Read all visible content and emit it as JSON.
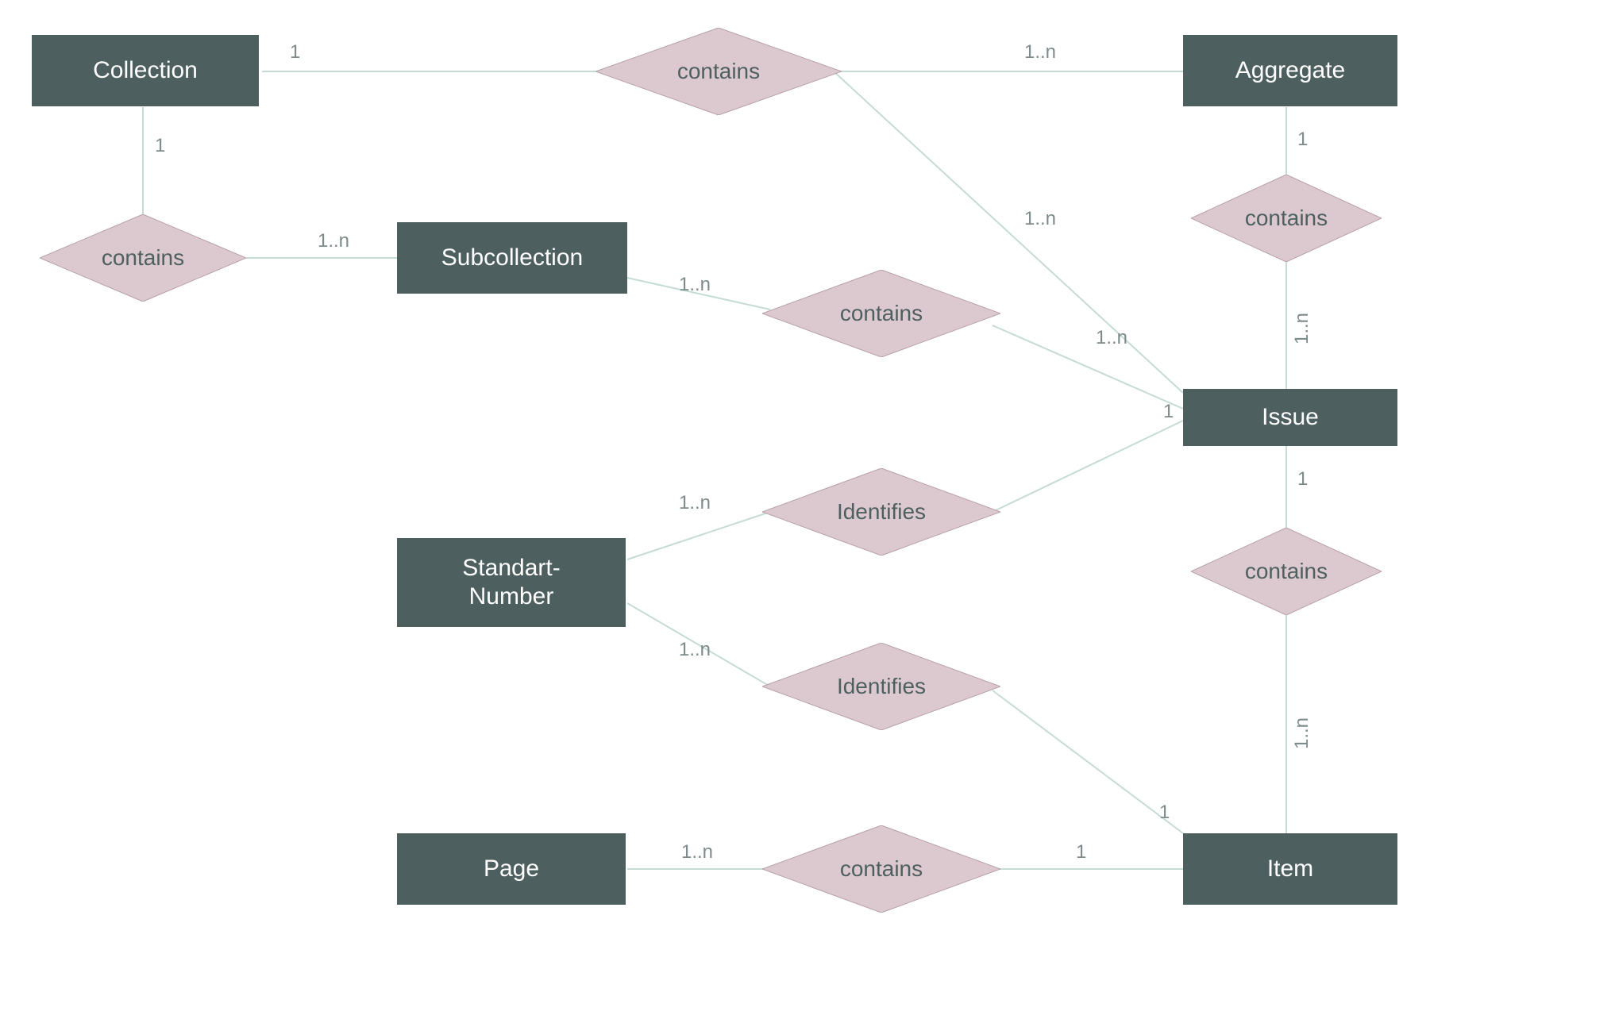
{
  "entities": {
    "collection": "Collection",
    "aggregate": "Aggregate",
    "subcollection": "Subcollection",
    "issue": "Issue",
    "standart_number_line1": "Standart-",
    "standart_number_line2": "Number",
    "page": "Page",
    "item": "Item"
  },
  "relationships": {
    "contains1": "contains",
    "contains2": "contains",
    "contains3": "contains",
    "contains4": "contains",
    "contains5": "contains",
    "contains6": "contains",
    "identifies1": "Identifies",
    "identifies2": "Identifies"
  },
  "cardinalities": {
    "c1": "1",
    "c2": "1",
    "c3": "1",
    "c4": "1",
    "c5": "1",
    "c6": "1",
    "c7": "1",
    "n1": "1..n",
    "n2": "1..n",
    "n3": "1..n",
    "n4": "1..n",
    "n5": "1..n",
    "n6": "1..n",
    "n7": "1..n",
    "n8": "1..n",
    "n9": "1..n",
    "n10": "1..n"
  },
  "colors": {
    "entity_fill": "#4e5f5f",
    "relationship_fill": "#dcc9cf",
    "relationship_stroke": "#b7a0a9",
    "connector": "#c5dcd2",
    "label": "#7e8b8b"
  }
}
